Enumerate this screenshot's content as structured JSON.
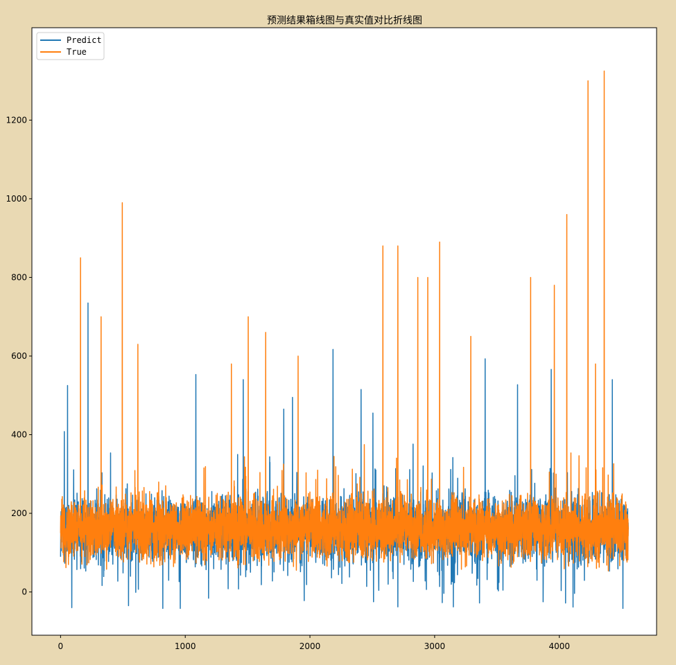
{
  "chart_data": {
    "type": "line",
    "title": "预测结果箱线图与真实值对比折线图",
    "xlabel": "",
    "ylabel": "",
    "xlim": [
      -230,
      4780
    ],
    "ylim": [
      -110,
      1435
    ],
    "x_ticks": [
      0,
      1000,
      2000,
      3000,
      4000
    ],
    "x_tick_labels": [
      "0",
      "1000",
      "2000",
      "3000",
      "4000"
    ],
    "y_ticks": [
      0,
      200,
      400,
      600,
      800,
      1000,
      1200
    ],
    "y_tick_labels": [
      "0",
      "200",
      "400",
      "600",
      "800",
      "1000",
      "1200"
    ],
    "legend_position": "top-left",
    "grid": false,
    "n_points": 4554,
    "series": [
      {
        "name": "Predict",
        "color": "#1f77b4",
        "summary": {
          "typical_range": [
            60,
            330
          ],
          "min": -42,
          "max": 735
        },
        "notable_peaks": [
          {
            "x": 56,
            "y": 525
          },
          {
            "x": 30,
            "y": 408
          },
          {
            "x": 220,
            "y": 735
          },
          {
            "x": 1085,
            "y": 553
          },
          {
            "x": 1465,
            "y": 540
          },
          {
            "x": 1790,
            "y": 465
          },
          {
            "x": 1860,
            "y": 495
          },
          {
            "x": 2185,
            "y": 617
          },
          {
            "x": 2410,
            "y": 515
          },
          {
            "x": 2505,
            "y": 455
          },
          {
            "x": 3405,
            "y": 593
          },
          {
            "x": 3665,
            "y": 527
          },
          {
            "x": 3935,
            "y": 566
          },
          {
            "x": 4425,
            "y": 540
          }
        ],
        "notable_troughs": [
          {
            "x": 90,
            "y": -40
          },
          {
            "x": 545,
            "y": -35
          },
          {
            "x": 2705,
            "y": -38
          },
          {
            "x": 3150,
            "y": -38
          },
          {
            "x": 4510,
            "y": -42
          },
          {
            "x": 4050,
            "y": -28
          },
          {
            "x": 3870,
            "y": -25
          },
          {
            "x": 2510,
            "y": -25
          },
          {
            "x": 3360,
            "y": -28
          }
        ]
      },
      {
        "name": "True",
        "color": "#ff7f0e",
        "summary": {
          "typical_range": [
            80,
            310
          ],
          "min": 15,
          "max": 1325
        },
        "notable_peaks": [
          {
            "x": 160,
            "y": 850
          },
          {
            "x": 325,
            "y": 700
          },
          {
            "x": 495,
            "y": 990
          },
          {
            "x": 620,
            "y": 630
          },
          {
            "x": 1370,
            "y": 580
          },
          {
            "x": 1505,
            "y": 700
          },
          {
            "x": 1645,
            "y": 660
          },
          {
            "x": 1905,
            "y": 600
          },
          {
            "x": 2585,
            "y": 880
          },
          {
            "x": 2705,
            "y": 880
          },
          {
            "x": 2865,
            "y": 800
          },
          {
            "x": 2945,
            "y": 800
          },
          {
            "x": 3040,
            "y": 890
          },
          {
            "x": 3290,
            "y": 650
          },
          {
            "x": 3770,
            "y": 800
          },
          {
            "x": 3960,
            "y": 780
          },
          {
            "x": 4060,
            "y": 960
          },
          {
            "x": 4230,
            "y": 1300
          },
          {
            "x": 4290,
            "y": 580
          },
          {
            "x": 4360,
            "y": 1325
          }
        ]
      }
    ]
  },
  "colors": {
    "background": "#e9d9b3",
    "plot_background": "#ffffff",
    "predict": "#1f77b4",
    "true": "#ff7f0e"
  }
}
